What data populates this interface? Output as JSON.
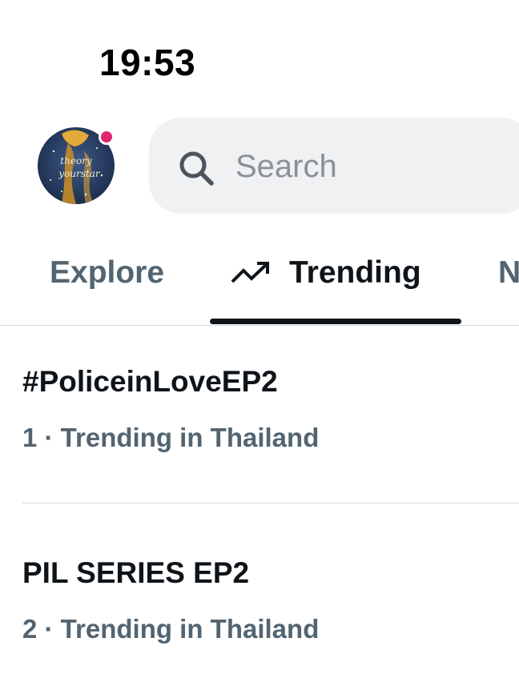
{
  "status_bar": {
    "time": "19:53"
  },
  "header": {
    "avatar": {
      "text": "theory of yourstar"
    },
    "search": {
      "placeholder": "Search",
      "icon": "search-icon"
    }
  },
  "tabs": [
    {
      "label": "Explore",
      "active": false
    },
    {
      "label": "Trending",
      "active": true,
      "icon": "trending-arrow-icon"
    },
    {
      "label": "N",
      "active": false
    }
  ],
  "trends": [
    {
      "title": "#PoliceinLoveEP2",
      "meta": "1 · Trending in Thailand"
    },
    {
      "title": "PIL SERIES EP2",
      "meta": "2 · Trending in Thailand"
    }
  ],
  "colors": {
    "text_primary": "#0f1419",
    "text_secondary": "#536471",
    "search_bg": "#eff1f3",
    "notification_dot": "#e0246f",
    "divider": "#cfd9de"
  }
}
